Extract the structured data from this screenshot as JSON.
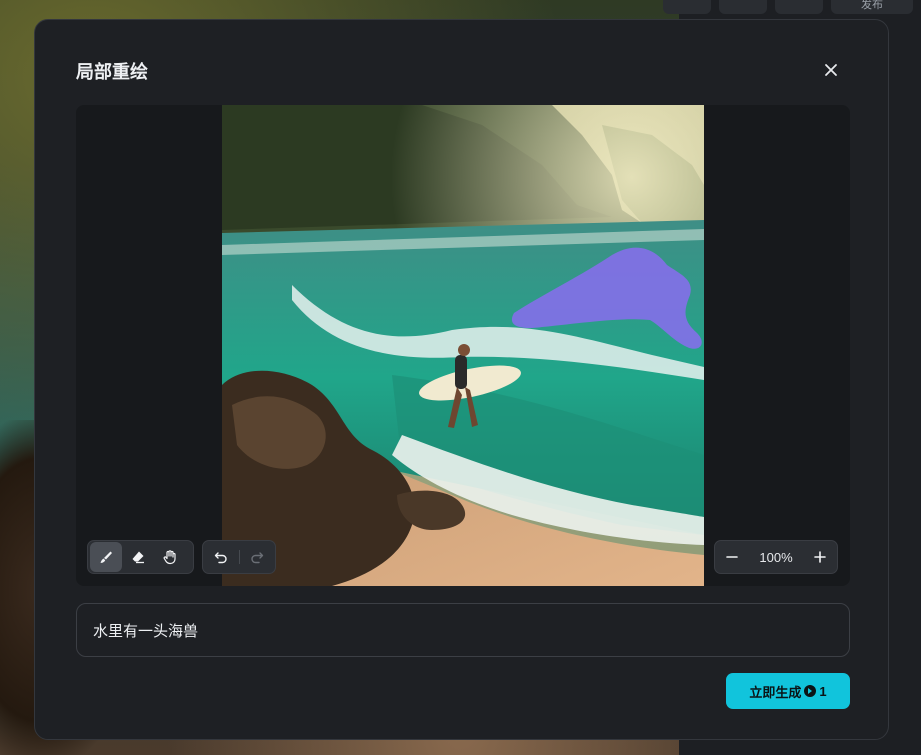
{
  "background": {
    "toolbar_buttons": [
      "",
      "",
      "",
      "发布"
    ]
  },
  "modal": {
    "title": "局部重绘",
    "close_icon": "close-icon"
  },
  "canvas": {
    "tools": {
      "brush": "brush-icon",
      "eraser": "eraser-icon",
      "hand": "hand-icon",
      "undo": "undo-icon",
      "redo": "redo-icon"
    },
    "zoom": {
      "value": "100%",
      "zoom_out_icon": "minus-icon",
      "zoom_in_icon": "plus-icon"
    },
    "mask_color": "#8a6cf0"
  },
  "prompt": {
    "value": "水里有一头海兽"
  },
  "generate": {
    "label": "立即生成",
    "cost": "1",
    "accent": "#11c4dc"
  }
}
